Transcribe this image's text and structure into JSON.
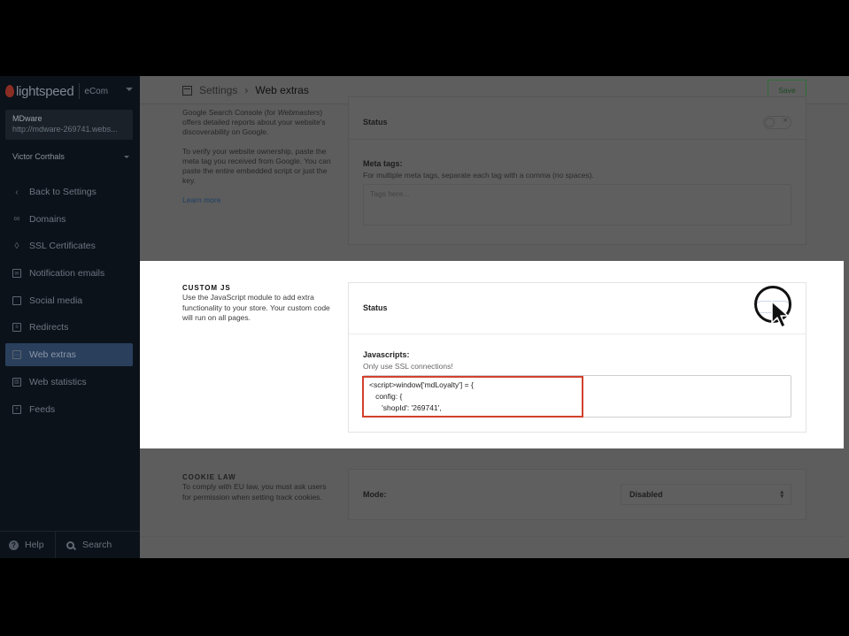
{
  "brand": {
    "name": "lightspeed",
    "product": "eCom"
  },
  "shop": {
    "name": "MDware",
    "url": "http://mdware-269741.webs..."
  },
  "user": {
    "name": "Victor Corthals"
  },
  "sidebar": {
    "items": [
      {
        "label": "Back to Settings",
        "icon": "chevron-left-icon",
        "active": false
      },
      {
        "label": "Domains",
        "icon": "link-icon",
        "active": false
      },
      {
        "label": "SSL Certificates",
        "icon": "shield-icon",
        "active": false
      },
      {
        "label": "Notification emails",
        "icon": "mail-icon",
        "active": false
      },
      {
        "label": "Social media",
        "icon": "chat-icon",
        "active": false
      },
      {
        "label": "Redirects",
        "icon": "list-icon",
        "active": false
      },
      {
        "label": "Web extras",
        "icon": "window-icon",
        "active": true
      },
      {
        "label": "Web statistics",
        "icon": "chart-icon",
        "active": false
      },
      {
        "label": "Feeds",
        "icon": "plus-box-icon",
        "active": false
      }
    ],
    "help_label": "Help",
    "search_label": "Search"
  },
  "header": {
    "breadcrumb_parent": "Settings",
    "breadcrumb_current": "Web extras",
    "save_label": "Save"
  },
  "meta_section": {
    "description_1a": "Google Search Console (for ",
    "description_1b": "Webmasters",
    "description_1c": ") offers detailed reports about your website's discoverability on Google.",
    "description_2": "To verify your website ownership, paste the meta tag you received from Google. You can paste the entire embedded script or just the key.",
    "learn_more": "Learn more",
    "status_label": "Status",
    "meta_tags_label": "Meta tags:",
    "meta_tags_help": "For multiple meta tags, separate each tag with a comma (no spaces).",
    "meta_tags_placeholder": "Tags here..."
  },
  "custom_js": {
    "title": "CUSTOM JS",
    "description": "Use the JavaScript module to add extra functionality to your store. Your custom code will run on all pages.",
    "status_label": "Status",
    "javascripts_label": "Javascripts:",
    "javascripts_help": "Only use SSL connections!",
    "code_value": "<script>window['mdLoyalty'] = {\n   config: {\n      'shopId': '269741',"
  },
  "cookie_law": {
    "title": "COOKIE LAW",
    "description": "To comply with EU law, you must ask users for permission when setting track cookies.",
    "mode_label": "Mode:",
    "mode_value": "Disabled"
  },
  "colors": {
    "sidebar_bg": "#0b121a",
    "active_nav": "#2a3f5c",
    "highlight_border": "#d2412c",
    "save_border": "#2f6f38"
  }
}
